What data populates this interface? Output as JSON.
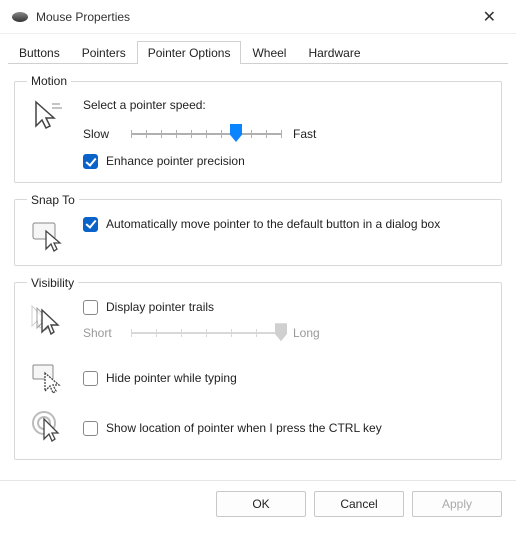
{
  "window": {
    "title": "Mouse Properties"
  },
  "tabs": {
    "buttons": "Buttons",
    "pointers": "Pointers",
    "pointer_options": "Pointer Options",
    "wheel": "Wheel",
    "hardware": "Hardware"
  },
  "motion": {
    "legend": "Motion",
    "prompt": "Select a pointer speed:",
    "slow": "Slow",
    "fast": "Fast",
    "enhance": "Enhance pointer precision"
  },
  "snap": {
    "legend": "Snap To",
    "auto": "Automatically move pointer to the default button in a dialog box"
  },
  "visibility": {
    "legend": "Visibility",
    "trails": "Display pointer trails",
    "short": "Short",
    "long": "Long",
    "hide": "Hide pointer while typing",
    "ctrl": "Show location of pointer when I press the CTRL key"
  },
  "buttons": {
    "ok": "OK",
    "cancel": "Cancel",
    "apply": "Apply"
  }
}
